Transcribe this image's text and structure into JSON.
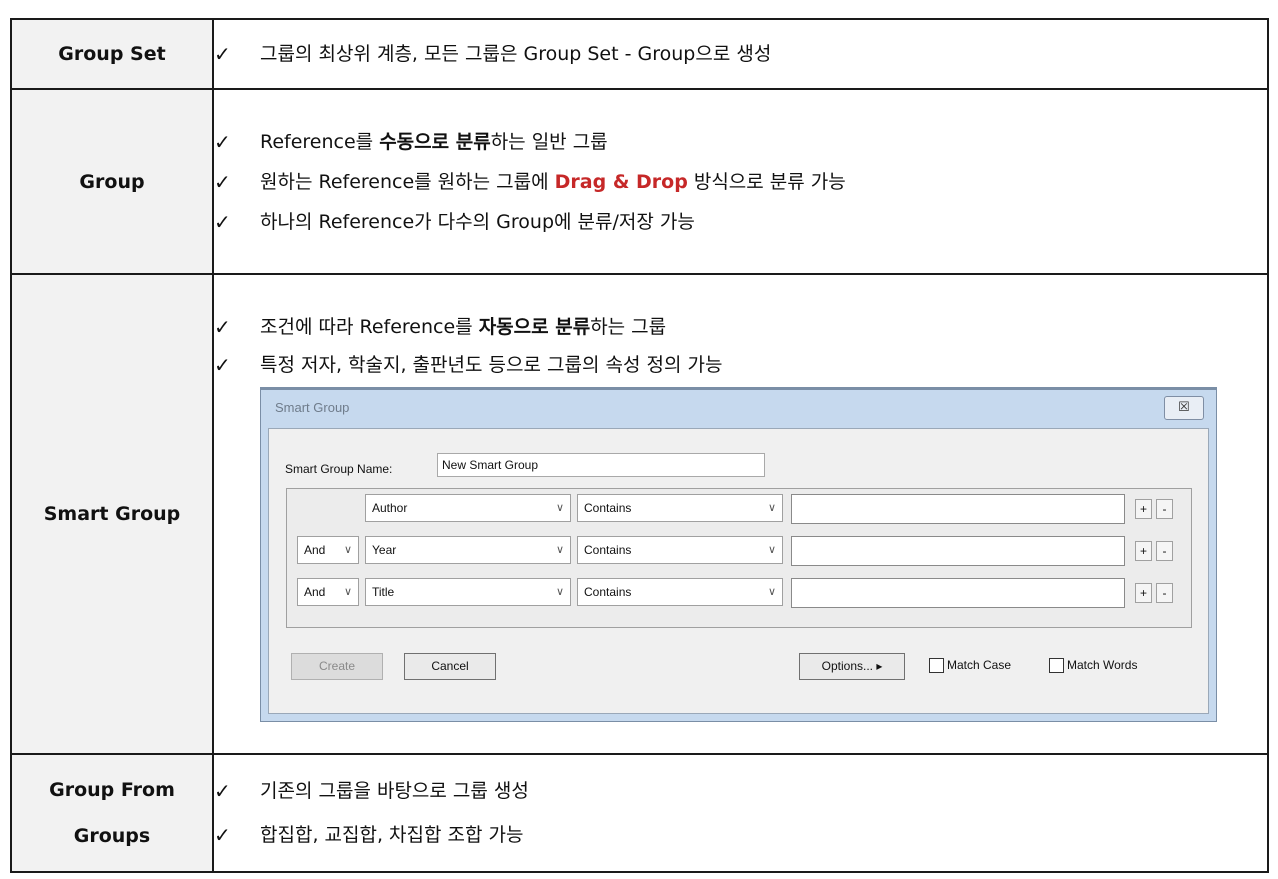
{
  "rows": [
    {
      "label": "Group Set",
      "items": [
        {
          "text": "그룹의 최상위 계층, 모든 그룹은 Group Set - Group으로 생성"
        }
      ]
    },
    {
      "label": "Group",
      "items": [
        {
          "pre": "Reference를 ",
          "bold": "수동으로 분류",
          "post": "하는 일반 그룹"
        },
        {
          "pre": "원하는 Reference를 원하는 그룹에 ",
          "red": "Drag & Drop",
          "post": " 방식으로 분류 가능"
        },
        {
          "text": "하나의 Reference가 다수의 Group에 분류/저장 가능"
        }
      ]
    },
    {
      "label": "Smart Group",
      "items": [
        {
          "pre": "조건에 따라 Reference를 ",
          "bold": "자동으로 분류",
          "post": "하는 그룹"
        },
        {
          "text": "특정 저자, 학술지, 출판년도 등으로 그룹의 속성 정의 가능"
        }
      ]
    },
    {
      "label_line1": "Group From",
      "label_line2": "Groups",
      "items": [
        {
          "text": "기존의 그룹을 바탕으로 그룹 생성"
        },
        {
          "text": "합집합, 교집합, 차집합 조합 가능"
        }
      ]
    }
  ],
  "check_glyph": "✓",
  "dialog": {
    "title": "Smart Group",
    "close_glyph": "☒",
    "name_label": "Smart Group Name:",
    "name_value": "New Smart Group",
    "criteria": [
      {
        "connector": "",
        "field": "Author",
        "operator": "Contains",
        "value": ""
      },
      {
        "connector": "And",
        "field": "Year",
        "operator": "Contains",
        "value": ""
      },
      {
        "connector": "And",
        "field": "Title",
        "operator": "Contains",
        "value": ""
      }
    ],
    "plus": "+",
    "minus": "-",
    "chevron": "∨",
    "create_label": "Create",
    "cancel_label": "Cancel",
    "options_label": "Options... ▸",
    "match_case_label": "Match Case",
    "match_words_label": "Match Words"
  }
}
